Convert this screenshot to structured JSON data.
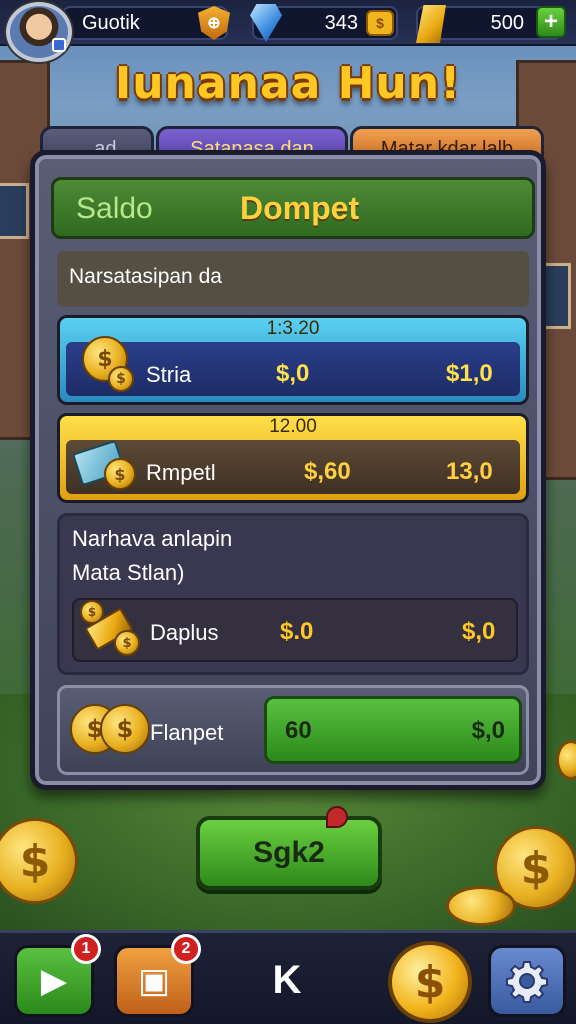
{
  "topbar": {
    "player_name": "Guotik",
    "gems": "343",
    "gold": "500"
  },
  "title": "Iunanaa Hun!",
  "tabs": [
    {
      "label": "...ad"
    },
    {
      "label": "Satanasa dan"
    },
    {
      "label": "Matar kdar lalb"
    }
  ],
  "panel": {
    "header_left": "Saldo",
    "header_title": "Dompet",
    "section_label": "Narsatasipan da",
    "rows": [
      {
        "header": "1:3.20",
        "label": "Stria",
        "value_a": "$,0",
        "value_b": "$1,0",
        "accent": "#2a8ac0"
      },
      {
        "header": "12.00",
        "label": "Rmpetl",
        "value_a": "$,60",
        "value_b": "13,0",
        "accent": "#e0a010"
      },
      {
        "title_a": "Narhava anlapin",
        "title_b": "Mata Stlan)",
        "label": "Daplus",
        "value_a": "$.0",
        "value_b": "$,0"
      },
      {
        "label": "Flanpet",
        "value_a": "60",
        "value_b": "$,0",
        "accent": "#2a8a1a"
      }
    ]
  },
  "claim_button": "Sgk2",
  "bottombar": {
    "badge_play": "1",
    "badge_box": "2",
    "logo": "K"
  },
  "icons": [
    "avatar",
    "shield-icon",
    "gem-icon",
    "coin-icon",
    "gold-bar-icon",
    "plus-icon",
    "gear-icon",
    "play-icon",
    "box-icon"
  ]
}
